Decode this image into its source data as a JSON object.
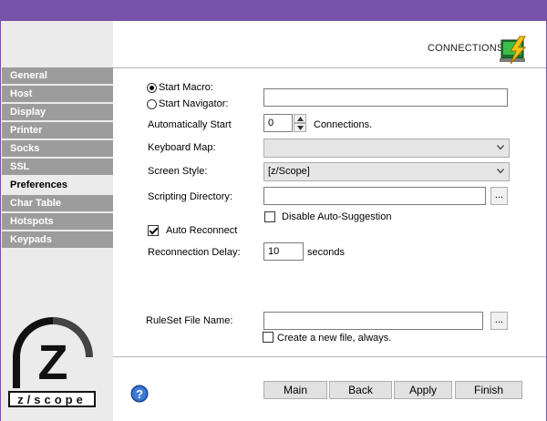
{
  "header": {
    "title": "CONNECTIONS",
    "icon": "connections-bolt-icon"
  },
  "sidebar": {
    "items": [
      {
        "label": "General",
        "active": false
      },
      {
        "label": "Host",
        "active": false
      },
      {
        "label": "Display",
        "active": false
      },
      {
        "label": "Printer",
        "active": false
      },
      {
        "label": "Socks",
        "active": false
      },
      {
        "label": "SSL",
        "active": false
      },
      {
        "label": "Preferences",
        "active": true
      },
      {
        "label": "Char Table",
        "active": false
      },
      {
        "label": "Hotspots",
        "active": false
      },
      {
        "label": "Keypads",
        "active": false
      }
    ],
    "logo": {
      "letter": "Z",
      "text": "z/scope"
    }
  },
  "form": {
    "start_macro_label": "Start Macro:",
    "start_macro_selected": true,
    "start_navigator_label": "Start Navigator:",
    "start_navigator_value": "",
    "auto_start_label": "Automatically Start",
    "auto_start_value": "0",
    "auto_start_suffix": "Connections.",
    "keyboard_map_label": "Keyboard Map:",
    "keyboard_map_value": "",
    "screen_style_label": "Screen Style:",
    "screen_style_value": "[z/Scope]",
    "scripting_dir_label": "Scripting Directory:",
    "scripting_dir_value": "",
    "browse_label": "...",
    "disable_autosuggest_label": "Disable Auto-Suggestion",
    "disable_autosuggest_checked": false,
    "auto_reconnect_label": "Auto Reconnect",
    "auto_reconnect_checked": true,
    "reconnect_delay_label": "Reconnection Delay:",
    "reconnect_delay_value": "10",
    "reconnect_delay_suffix": "seconds",
    "ruleset_label": "RuleSet File Name:",
    "ruleset_value": "",
    "create_new_file_label": "Create a new file, always.",
    "create_new_file_checked": false
  },
  "footer": {
    "main_label": "Main",
    "back_label": "Back",
    "apply_label": "Apply",
    "finish_label": "Finish"
  },
  "colors": {
    "titlebar": "#7851a9",
    "sidebar_item": "#9c9c9c",
    "sidebar_bg": "#ebebeb"
  }
}
